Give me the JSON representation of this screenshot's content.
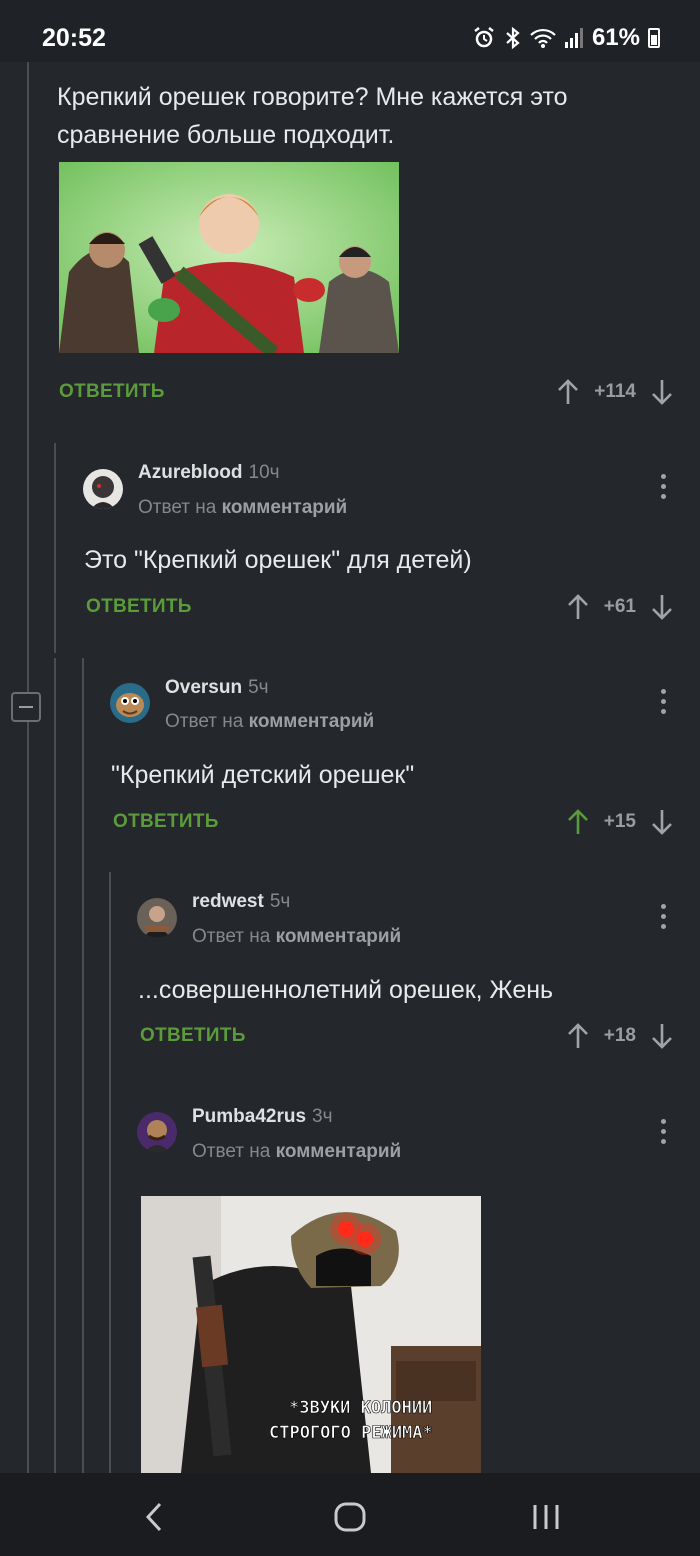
{
  "status_bar": {
    "time": "20:52",
    "battery": "61%"
  },
  "comments": [
    {
      "text": "Крепкий орешек говорите? Мне кажется это сравнение больше подходит.",
      "reply_label": "ОТВЕТИТЬ",
      "score": "+114"
    },
    {
      "username": "Azureblood",
      "age": "10ч",
      "reply_to_prefix": "Ответ на",
      "reply_to_link": "комментарий",
      "text": "Это \"Крепкий орешек\" для детей)",
      "reply_label": "ОТВЕТИТЬ",
      "score": "+61"
    },
    {
      "username": "Oversun",
      "age": "5ч",
      "reply_to_prefix": "Ответ на",
      "reply_to_link": "комментарий",
      "text": "\"Крепкий детский орешек\"",
      "reply_label": "ОТВЕТИТЬ",
      "score": "+15",
      "upvoted": true
    },
    {
      "username": "redwest",
      "age": "5ч",
      "reply_to_prefix": "Ответ на",
      "reply_to_link": "комментарий",
      "text": "...совершеннолетний орешек, Жень",
      "reply_label": "ОТВЕТИТЬ",
      "score": "+18"
    },
    {
      "username": "Pumba42rus",
      "age": "3ч",
      "reply_to_prefix": "Ответ на",
      "reply_to_link": "комментарий",
      "image_caption_line1": "*ЗВУКИ КОЛОНИИ",
      "image_caption_line2": "СТРОГОГО РЕЖИМА*"
    }
  ],
  "colors": {
    "background": "#24272c",
    "accent_green": "#5c9b3a",
    "muted": "#85888d"
  },
  "icons": [
    "alarm-icon",
    "bluetooth-icon",
    "wifi-icon",
    "signal-icon",
    "battery-icon",
    "upvote-icon",
    "downvote-icon",
    "more-icon",
    "collapse-icon",
    "back-icon",
    "home-icon",
    "recents-icon"
  ]
}
